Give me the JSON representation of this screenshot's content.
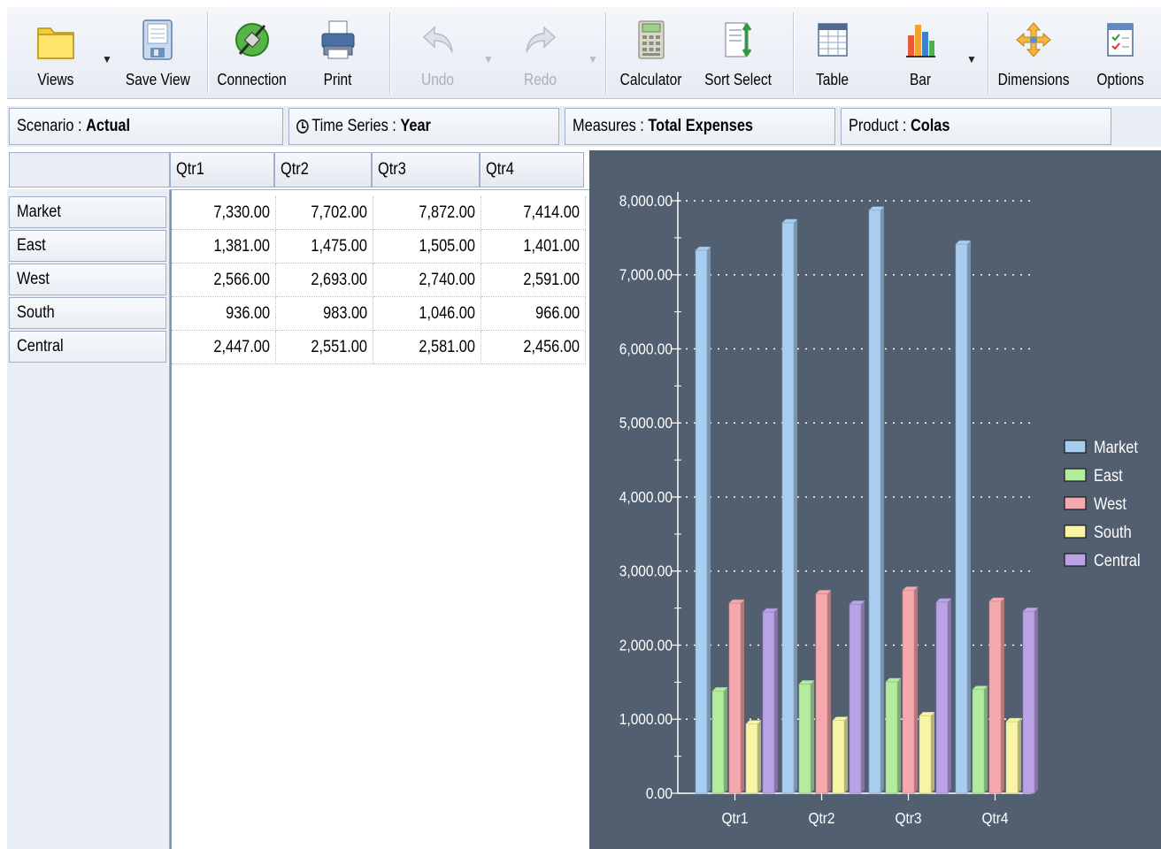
{
  "toolbar": {
    "buttons": [
      {
        "id": "views",
        "label": "Views",
        "icon": "folder-icon"
      },
      {
        "id": "save_view",
        "label": "Save View",
        "icon": "save-view-icon"
      },
      {
        "id": "connection",
        "label": "Connection",
        "icon": "connection-icon"
      },
      {
        "id": "print",
        "label": "Print",
        "icon": "printer-icon"
      },
      {
        "id": "undo",
        "label": "Undo",
        "icon": "undo-icon",
        "disabled": true
      },
      {
        "id": "redo",
        "label": "Redo",
        "icon": "redo-icon",
        "disabled": true
      },
      {
        "id": "calculator",
        "label": "Calculator",
        "icon": "calculator-icon"
      },
      {
        "id": "sort_select",
        "label": "Sort Select",
        "icon": "sort-select-icon"
      },
      {
        "id": "table",
        "label": "Table",
        "icon": "table-icon"
      },
      {
        "id": "bar",
        "label": "Bar",
        "icon": "bar-chart-icon"
      },
      {
        "id": "dimensions",
        "label": "Dimensions",
        "icon": "dimensions-icon"
      },
      {
        "id": "options",
        "label": "Options",
        "icon": "options-icon"
      }
    ]
  },
  "pov": {
    "scenario": {
      "key": "Scenario :",
      "value": "Actual"
    },
    "time_series": {
      "key": "Time Series :",
      "value": "Year"
    },
    "measures": {
      "key": "Measures :",
      "value": "Total Expenses"
    },
    "product": {
      "key": "Product :",
      "value": "Colas"
    }
  },
  "grid": {
    "columns": [
      "Qtr1",
      "Qtr2",
      "Qtr3",
      "Qtr4"
    ],
    "rows": [
      {
        "label": "Market",
        "values": [
          "7,330.00",
          "7,702.00",
          "7,872.00",
          "7,414.00"
        ]
      },
      {
        "label": "East",
        "values": [
          "1,381.00",
          "1,475.00",
          "1,505.00",
          "1,401.00"
        ]
      },
      {
        "label": "West",
        "values": [
          "2,566.00",
          "2,693.00",
          "2,740.00",
          "2,591.00"
        ]
      },
      {
        "label": "South",
        "values": [
          "936.00",
          "983.00",
          "1,046.00",
          "966.00"
        ]
      },
      {
        "label": "Central",
        "values": [
          "2,447.00",
          "2,551.00",
          "2,581.00",
          "2,456.00"
        ]
      }
    ]
  },
  "chart_data": {
    "type": "bar",
    "categories": [
      "Qtr1",
      "Qtr2",
      "Qtr3",
      "Qtr4"
    ],
    "series": [
      {
        "name": "Market",
        "values": [
          7330,
          7702,
          7872,
          7414
        ],
        "color": "#a9cdef"
      },
      {
        "name": "East",
        "values": [
          1381,
          1475,
          1505,
          1401
        ],
        "color": "#b3ec9f"
      },
      {
        "name": "West",
        "values": [
          2566,
          2693,
          2740,
          2591
        ],
        "color": "#f5a9ae"
      },
      {
        "name": "South",
        "values": [
          936,
          983,
          1046,
          966
        ],
        "color": "#f8f6a4"
      },
      {
        "name": "Central",
        "values": [
          2447,
          2551,
          2581,
          2456
        ],
        "color": "#b9a3e4"
      }
    ],
    "ylim": [
      0,
      8000
    ],
    "yticks": [
      "0.00",
      "1,000.00",
      "2,000.00",
      "3,000.00",
      "4,000.00",
      "5,000.00",
      "6,000.00",
      "7,000.00",
      "8,000.00"
    ],
    "grid": true,
    "legend": "right"
  },
  "colors": {
    "chart_bg": "#525f70",
    "header_bg": "#e9eef5",
    "border": "#9fb0c8"
  }
}
